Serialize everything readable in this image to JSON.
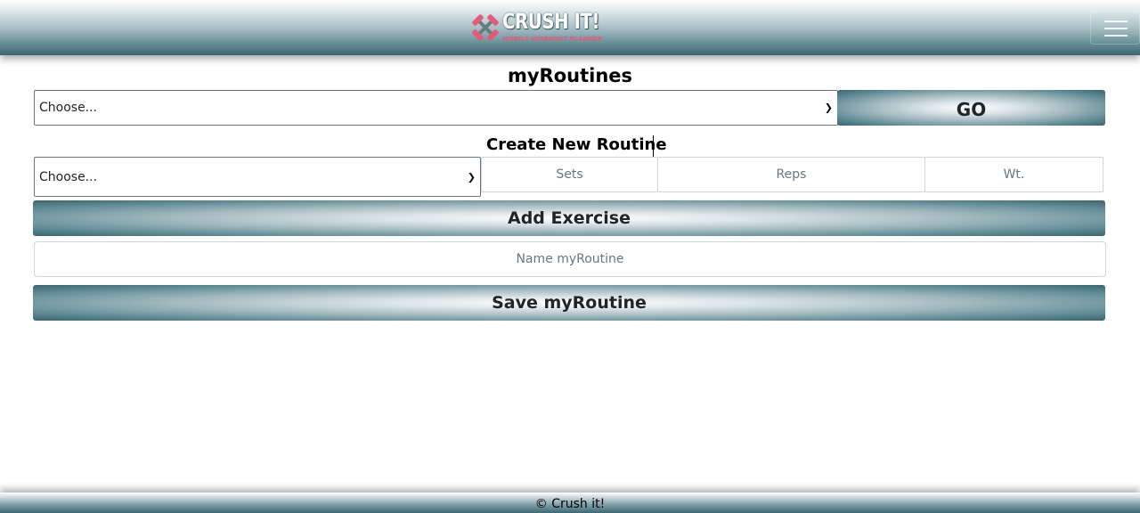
{
  "header": {
    "brand": {
      "title": "CRUSH IT!",
      "tagline": "MOBILE WORKOUT PLANNER",
      "icon": "crossed-dumbbells-icon"
    },
    "menu_icon": "hamburger-menu-icon"
  },
  "routines": {
    "heading": "myRoutines",
    "select_value": "Choose...",
    "go_label": "GO"
  },
  "create": {
    "heading": "Create New Routine",
    "exercise_select_value": "Choose...",
    "sets_placeholder": "Sets",
    "reps_placeholder": "Reps",
    "weight_placeholder": "Wt.",
    "add_label": "Add Exercise",
    "name_placeholder": "Name myRoutine",
    "save_label": "Save myRoutine"
  },
  "footer": {
    "text": "© Crush it!"
  },
  "colors": {
    "header_dark": "#3e6670",
    "button_light": "#ffffff",
    "button_dark": "#3b6470",
    "brand_pink": "#e45a7b"
  }
}
